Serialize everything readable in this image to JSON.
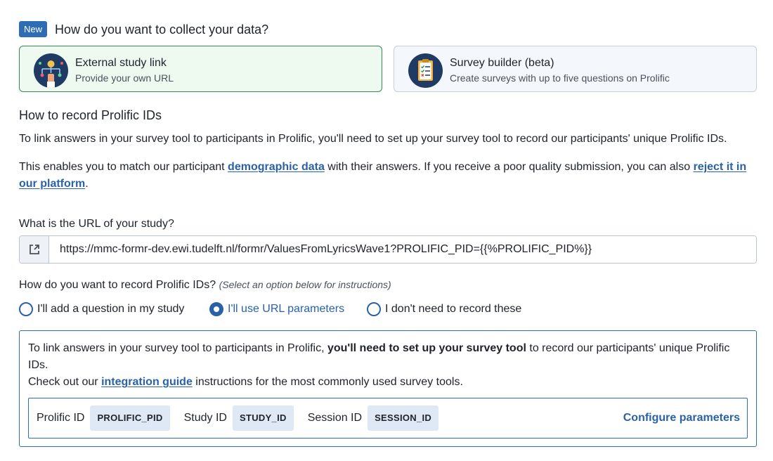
{
  "header": {
    "badge": "New",
    "title": "How do you want to collect your data?"
  },
  "methods": [
    {
      "title": "External study link",
      "subtitle": "Provide your own URL",
      "icon": "external-link-illustration-icon",
      "selected": true
    },
    {
      "title": "Survey builder (beta)",
      "subtitle": "Create surveys with up to five questions on Prolific",
      "icon": "clipboard-checklist-icon",
      "selected": false
    }
  ],
  "record_ids": {
    "title": "How to record Prolific IDs",
    "para1": "To link answers in your survey tool to participants in Prolific, you'll need to set up your survey tool to record our participants' unique Prolific IDs.",
    "para2_before": "This enables you to match our participant ",
    "para2_link1": "demographic data",
    "para2_middle": " with their answers. If you receive a poor quality submission, you can also ",
    "para2_link2": "reject it in our platform",
    "para2_after": "."
  },
  "url_field": {
    "label": "What is the URL of your study?",
    "value": "https://mmc-formr-dev.ewi.tudelft.nl/formr/ValuesFromLyricsWave1?PROLIFIC_PID={{%PROLIFIC_PID%}}",
    "addon_icon": "external-link-icon"
  },
  "record_method": {
    "label": "How do you want to record Prolific IDs?",
    "hint": "(Select an option below for instructions)",
    "options": [
      {
        "label": "I'll add a question in my study",
        "selected": false
      },
      {
        "label": "I'll use URL parameters",
        "selected": true
      },
      {
        "label": "I don't need to record these",
        "selected": false
      }
    ]
  },
  "info": {
    "line1_before": "To link answers in your survey tool to participants in Prolific, ",
    "line1_bold": "you'll need to set up your survey tool",
    "line1_after": " to record our participants' unique Prolific IDs.",
    "line2_before": "Check out our ",
    "line2_link": "integration guide",
    "line2_after": " instructions for the most commonly used survey tools."
  },
  "parameters": [
    {
      "label": "Prolific ID",
      "value": "PROLIFIC_PID"
    },
    {
      "label": "Study ID",
      "value": "STUDY_ID"
    },
    {
      "label": "Session ID",
      "value": "SESSION_ID"
    }
  ],
  "configure_label": "Configure parameters",
  "colors": {
    "accent": "#2a62a8",
    "selected_card_bg": "#eefaf0",
    "selected_card_border": "#2f8e4f",
    "badge": "#2e6db3"
  }
}
